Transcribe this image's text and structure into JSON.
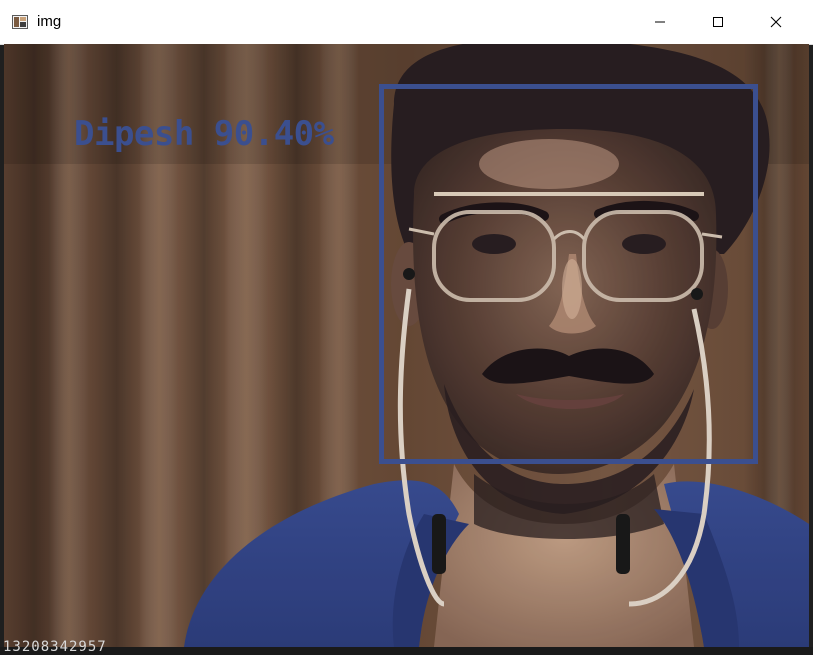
{
  "window": {
    "title": "img",
    "app_icon": "opencv-window-icon",
    "controls": {
      "minimize_icon": "minimize-icon",
      "maximize_icon": "maximize-icon",
      "close_icon": "close-icon"
    }
  },
  "detection": {
    "label": "Dipesh 90.40%",
    "name": "Dipesh",
    "confidence": "90.40%"
  },
  "status": {
    "readout": "13208342957"
  },
  "colors": {
    "accent": "#3b4f8f",
    "titlebar": "#ffffff"
  }
}
